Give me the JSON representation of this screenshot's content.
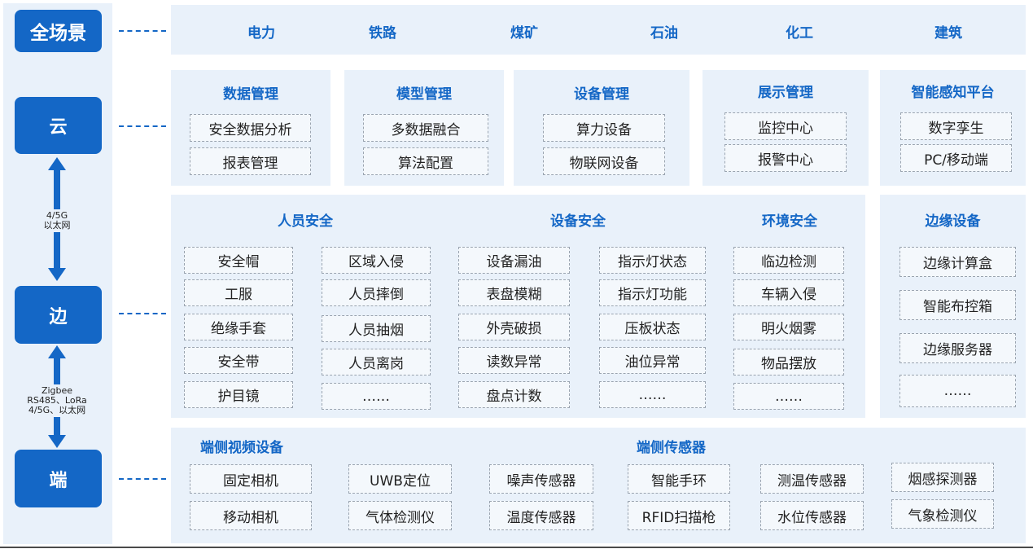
{
  "tiers": {
    "quanchangjing": "全场景",
    "yun": "云",
    "bian": "边",
    "duan": "端"
  },
  "links": {
    "yun_bian": [
      "4/5G",
      "以太网"
    ],
    "bian_duan": [
      "Zigbee",
      "RS485、LoRa",
      "4/5G、以太网"
    ]
  },
  "industries": [
    "电力",
    "铁路",
    "煤矿",
    "石油",
    "化工",
    "建筑"
  ],
  "cloud": {
    "groups": [
      {
        "title": "数据管理",
        "items": [
          "安全数据分析",
          "报表管理"
        ]
      },
      {
        "title": "模型管理",
        "items": [
          "多数据融合",
          "算法配置"
        ]
      },
      {
        "title": "设备管理",
        "items": [
          "算力设备",
          "物联网设备"
        ]
      },
      {
        "title": "展示管理",
        "items": [
          "监控中心",
          "报警中心"
        ]
      },
      {
        "title": "智能感知平台",
        "items": [
          "数字孪生",
          "PC/移动端"
        ]
      }
    ]
  },
  "edge": {
    "sections": [
      "人员安全",
      "设备安全",
      "环境安全"
    ],
    "columns": [
      [
        "安全帽",
        "工服",
        "绝缘手套",
        "安全带",
        "护目镜"
      ],
      [
        "区域入侵",
        "人员摔倒",
        "人员抽烟",
        "人员离岗",
        "……"
      ],
      [
        "设备漏油",
        "表盘模糊",
        "外壳破损",
        "读数异常",
        "盘点计数"
      ],
      [
        "指示灯状态",
        "指示灯功能",
        "压板状态",
        "油位异常",
        "……"
      ],
      [
        "临边检测",
        "车辆入侵",
        "明火烟雾",
        "物品摆放",
        "……"
      ]
    ],
    "devices": {
      "title": "边缘设备",
      "items": [
        "边缘计算盒",
        "智能布控箱",
        "边缘服务器",
        "……"
      ]
    }
  },
  "terminal": {
    "video_title": "端侧视频设备",
    "sensor_title": "端侧传感器",
    "columns": [
      [
        "固定相机",
        "移动相机"
      ],
      [
        "UWB定位",
        "气体检测仪"
      ],
      [
        "噪声传感器",
        "温度传感器"
      ],
      [
        "智能手环",
        "RFID扫描枪"
      ],
      [
        "测温传感器",
        "水位传感器"
      ],
      [
        "烟感探测器",
        "气象检测仪"
      ]
    ]
  },
  "colors": {
    "accent": "#1467c6",
    "panel": "#e9f1fa",
    "box_border": "#9aa4b0"
  }
}
